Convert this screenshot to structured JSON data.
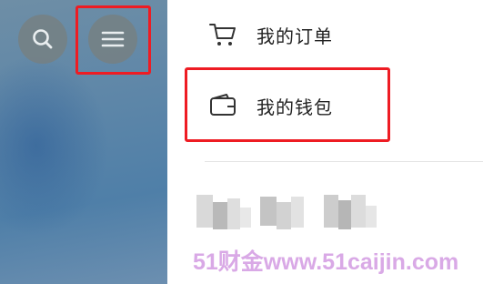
{
  "menu": {
    "items": [
      {
        "label": "我的订单",
        "icon": "cart-icon"
      },
      {
        "label": "我的钱包",
        "icon": "wallet-icon"
      }
    ]
  },
  "header": {
    "search_icon": "search-icon",
    "menu_icon": "hamburger-menu-icon"
  },
  "watermark": {
    "text": "51财金www.51caijin.com"
  },
  "colors": {
    "highlight": "#ee1c23",
    "watermark": "#d9a9e6",
    "circle_button": "#767f82"
  }
}
